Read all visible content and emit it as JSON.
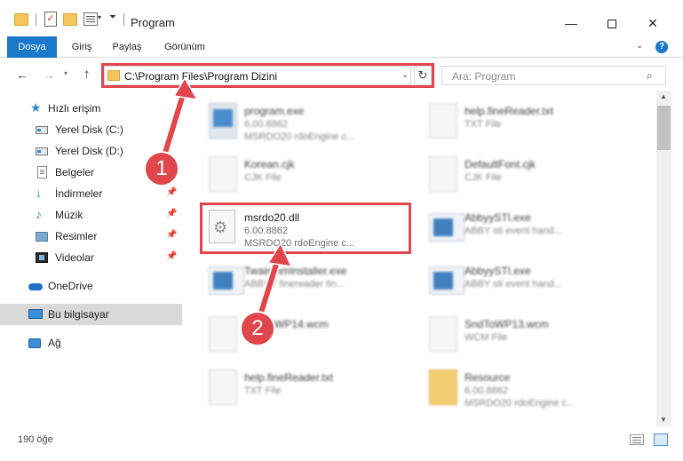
{
  "window": {
    "title": "Program",
    "minimize_label": "—",
    "close_label": "✕"
  },
  "ribbon": {
    "tabs": [
      "Dosya",
      "Giriş",
      "Paylaş",
      "Görünüm"
    ]
  },
  "address": {
    "path": "C:\\Program Files\\Program Dizini",
    "search_placeholder": "Ara: Program"
  },
  "sidebar": {
    "items": [
      {
        "label": "Hızlı erişim",
        "icon": "star-icon"
      },
      {
        "label": "Yerel Disk (C:)",
        "icon": "disk-icon"
      },
      {
        "label": "Yerel Disk (D:)",
        "icon": "disk-icon"
      },
      {
        "label": "Belgeler",
        "icon": "documents-icon"
      },
      {
        "label": "İndirmeler",
        "icon": "downloads-icon"
      },
      {
        "label": "Müzik",
        "icon": "music-icon"
      },
      {
        "label": "Resimler",
        "icon": "pictures-icon"
      },
      {
        "label": "Videolar",
        "icon": "videos-icon"
      },
      {
        "label": "OneDrive",
        "icon": "cloud-icon"
      },
      {
        "label": "Bu bilgisayar",
        "icon": "computer-icon"
      },
      {
        "label": "Ağ",
        "icon": "network-icon"
      }
    ]
  },
  "files": [
    {
      "name": "program.exe",
      "line2": "6.00.8862",
      "line3": "MSRDO20 rdoEngine c...",
      "icon": "exe-icon"
    },
    {
      "name": "help.fineReader.txt",
      "line2": "TXT File",
      "line3": "",
      "icon": "text-file-icon"
    },
    {
      "name": "Korean.cjk",
      "line2": "CJK File",
      "line3": "",
      "icon": "file-icon"
    },
    {
      "name": "DefaultFont.cjk",
      "line2": "CJK File",
      "line3": "",
      "icon": "file-icon"
    },
    {
      "name": "msrdo20.dll",
      "line2": "6.00.8862",
      "line3": "MSRDO20 rdoEngine c...",
      "icon": "dll-gear-icon"
    },
    {
      "name": "AbbyySTI.exe",
      "line2": "ABBY sti event hand...",
      "line3": "",
      "icon": "app-icon"
    },
    {
      "name": "TwainmmInstaller.exe",
      "line2": "ABBYY finereader tin...",
      "line3": "",
      "icon": "app-icon"
    },
    {
      "name": "AbbyySTI.exe",
      "line2": "ABBY sti event hand...",
      "line3": "",
      "icon": "app-icon"
    },
    {
      "name": "SndToWP14.wcm",
      "line2": "",
      "line3": "",
      "icon": "file-icon"
    },
    {
      "name": "SndToWP13.wcm",
      "line2": "WCM File",
      "line3": "",
      "icon": "file-icon"
    },
    {
      "name": "help.fineReader.txt",
      "line2": "TXT File",
      "line3": "",
      "icon": "text-file-icon"
    },
    {
      "name": "Resource",
      "line2": "6.00.8862",
      "line3": "MSRDO20 rdoEngine c...",
      "icon": "folder-icon"
    }
  ],
  "status": {
    "count": "190 öğe"
  },
  "callouts": [
    "1",
    "2"
  ],
  "colors": {
    "accent": "#1979ca",
    "highlight": "#e0464b"
  }
}
